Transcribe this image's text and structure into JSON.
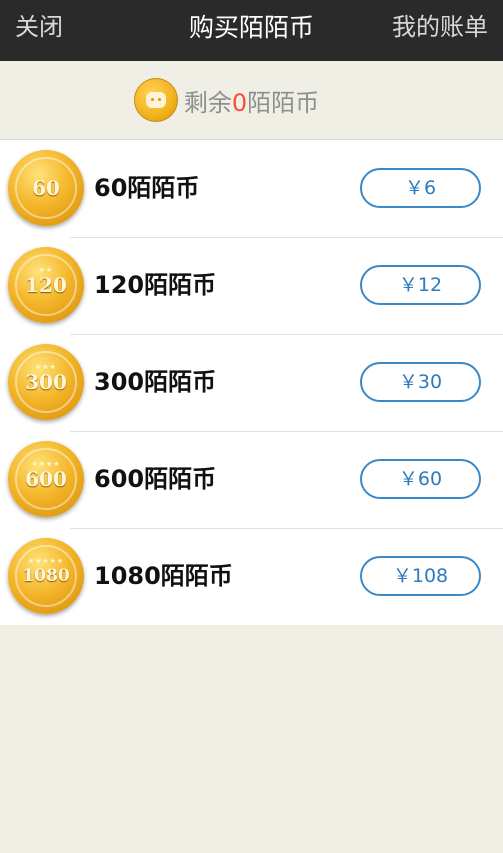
{
  "navbar": {
    "close_label": "关闭",
    "title": "购买陌陌币",
    "bills_label": "我的账单"
  },
  "balance": {
    "prefix": "剩余",
    "amount": "0",
    "suffix": "陌陌币"
  },
  "packages": [
    {
      "coin_text": "60",
      "label": "60陌陌币",
      "price": "￥6"
    },
    {
      "coin_text": "120",
      "label": "120陌陌币",
      "price": "￥12"
    },
    {
      "coin_text": "300",
      "label": "300陌陌币",
      "price": "￥30"
    },
    {
      "coin_text": "600",
      "label": "600陌陌币",
      "price": "￥60"
    },
    {
      "coin_text": "1080",
      "label": "1080陌陌币",
      "price": "￥108"
    }
  ],
  "colors": {
    "navbar_bg": "#2a2a2a",
    "page_bg": "#f0efe6",
    "accent_blue": "#3b88c7",
    "balance_highlight": "#ff4a3a",
    "coin_gold": "#f4b62a"
  }
}
